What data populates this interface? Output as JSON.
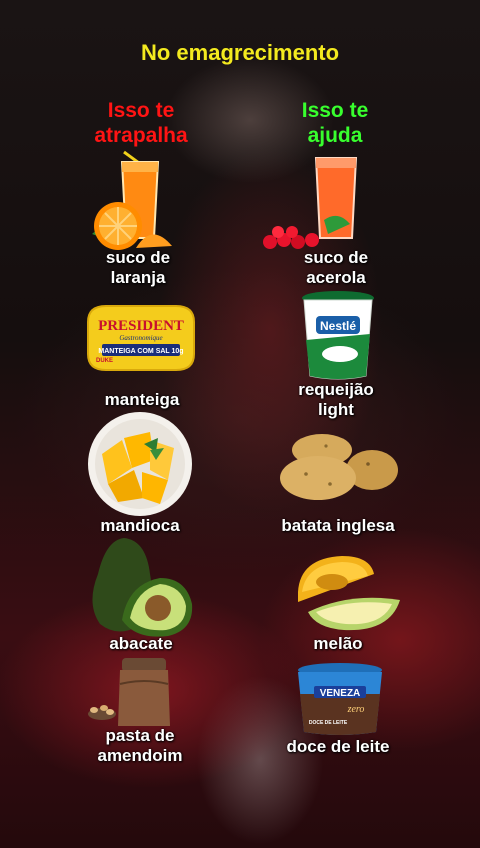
{
  "title": "No emagrecimento",
  "columns": {
    "bad": {
      "line1": "Isso te",
      "line2": "atrapalha",
      "color": "#ff1414"
    },
    "good": {
      "line1": "Isso te",
      "line2": "ajuda",
      "color": "#38ff2e"
    }
  },
  "pairs": [
    {
      "bad": {
        "line1": "suco de",
        "line2": "laranja",
        "icon": "orange-juice-icon"
      },
      "good": {
        "line1": "suco de",
        "line2": "acerola",
        "icon": "acerola-juice-icon"
      }
    },
    {
      "bad": {
        "line1": "manteiga",
        "icon": "butter-icon",
        "brand": "PRESIDENT",
        "sub": "Gastronomique",
        "tag": "MANTEIGA COM SAL 10g",
        "badge": "DUKE"
      },
      "good": {
        "line1": "requeijão",
        "line2": "light",
        "icon": "cream-cheese-cup-icon",
        "brand": "Nestlé"
      }
    },
    {
      "bad": {
        "line1": "mandioca",
        "icon": "cassava-icon"
      },
      "good": {
        "line1": "batata inglesa",
        "icon": "potato-icon"
      }
    },
    {
      "bad": {
        "line1": "abacate",
        "icon": "avocado-icon"
      },
      "good": {
        "line1": "melão",
        "icon": "melon-icon"
      }
    },
    {
      "bad": {
        "line1": "pasta de",
        "line2": "amendoim",
        "icon": "peanut-butter-icon"
      },
      "good": {
        "line1": "doce de leite",
        "icon": "dulce-de-leche-icon",
        "brand": "VENEZA",
        "tag": "zero",
        "sub": "DOCE DE LEITE"
      }
    }
  ]
}
